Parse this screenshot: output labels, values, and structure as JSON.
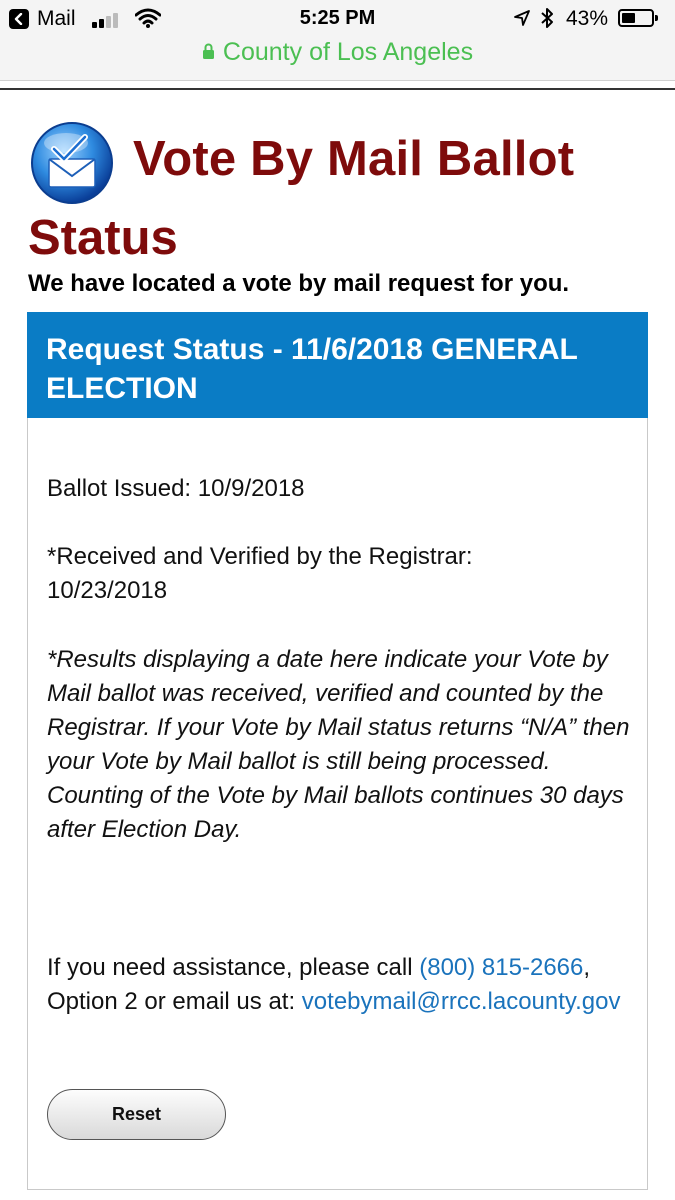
{
  "status_bar": {
    "back_label": "Mail",
    "time": "5:25 PM",
    "battery": "43%"
  },
  "url_bar": {
    "site": "County of Los Angeles"
  },
  "page": {
    "title_line1": "Vote By Mail Ballot",
    "title_line2": "Status",
    "located_message": "We have located a vote by mail request for you."
  },
  "panel": {
    "header": "Request Status - 11/6/2018 GENERAL ELECTION",
    "ballot_issued": "Ballot Issued: 10/9/2018",
    "received_label": "*Received and Verified by the Registrar:",
    "received_date": "10/23/2018",
    "note": "*Results displaying a date here indicate your Vote by Mail ballot was received, verified and counted by the Registrar. If your Vote by Mail status returns “N/A” then your Vote by Mail ballot is still being processed. Counting of the Vote by Mail ballots continues 30 days after Election Day.",
    "assist_prefix": "If you need assistance, please call ",
    "phone": "(800) 815-2666",
    "assist_middle": ", Option 2 or email us at: ",
    "email": "votebymail@rrcc.lacounty.gov",
    "reset_label": "Reset"
  },
  "colors": {
    "title": "#7e0b0b",
    "header_bg": "#0a7cc5",
    "link": "#1a73bc",
    "url_green": "#4bbf52"
  }
}
